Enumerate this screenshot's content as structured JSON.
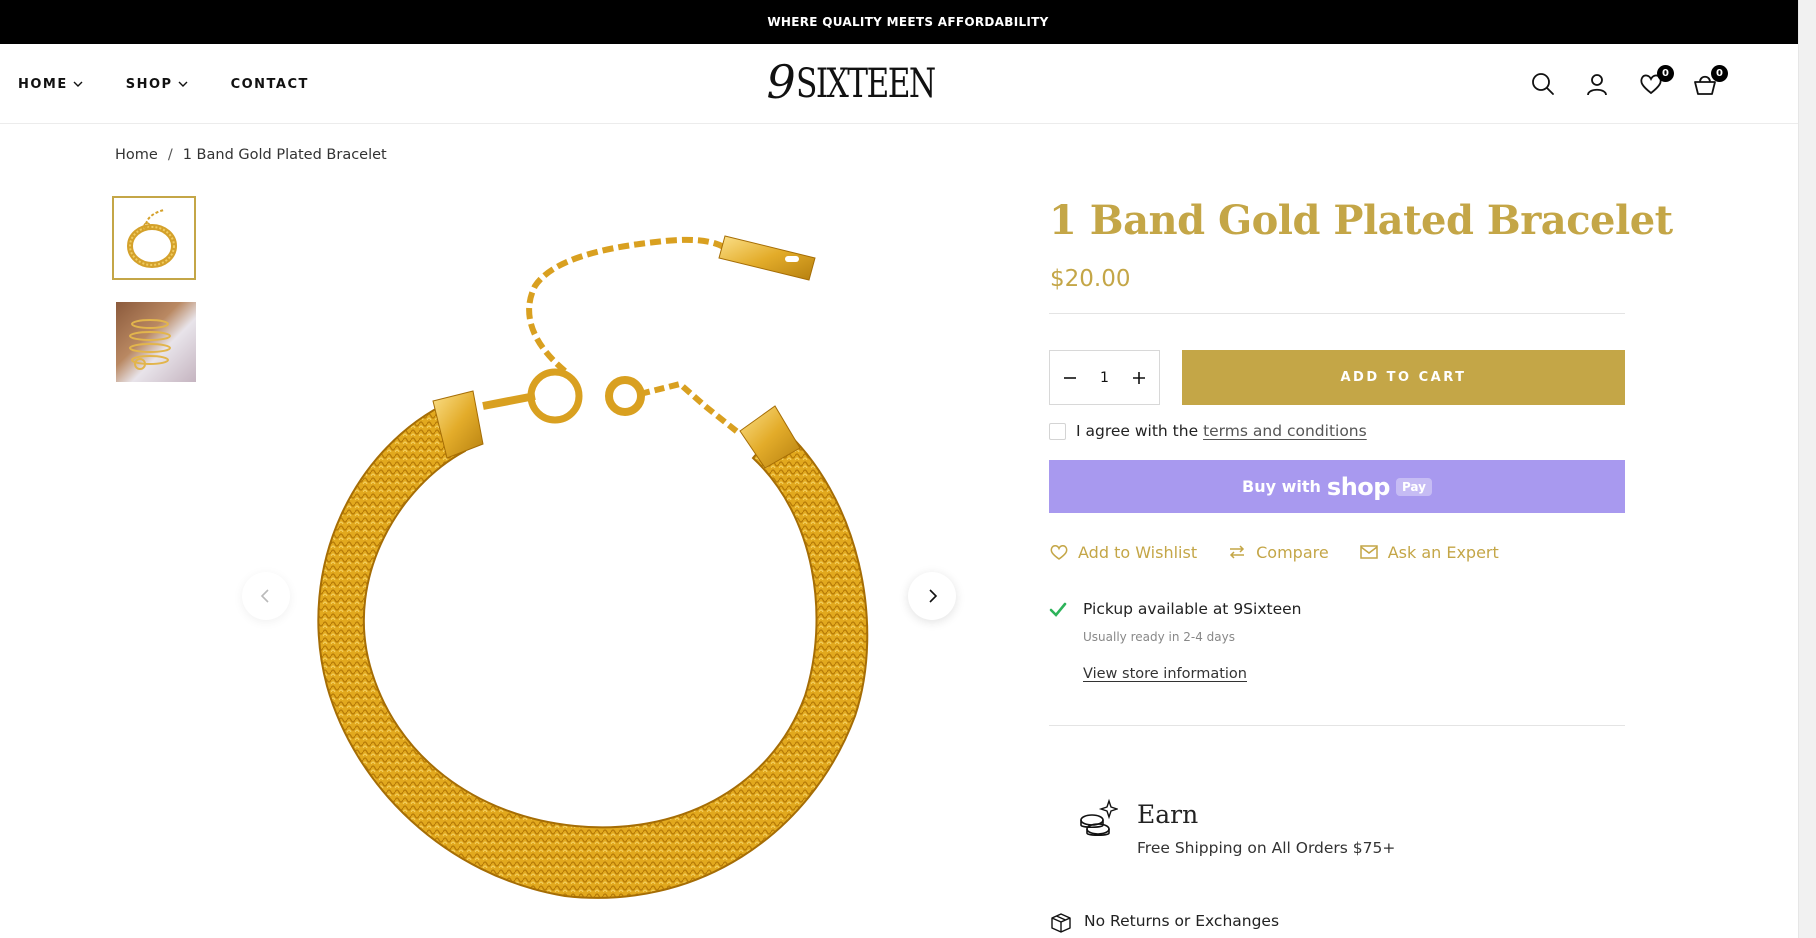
{
  "announcement": "WHERE QUALITY MEETS AFFORDABILITY",
  "nav": [
    {
      "label": "HOME",
      "dropdown": true
    },
    {
      "label": "SHOP",
      "dropdown": true
    },
    {
      "label": "CONTACT",
      "dropdown": false
    }
  ],
  "logo": {
    "nine": "9",
    "word": "SIXTEEN"
  },
  "header_icons": {
    "wishlist_count": "0",
    "cart_count": "0"
  },
  "breadcrumb": {
    "home": "Home",
    "separator": "/",
    "current": "1 Band Gold Plated Bracelet"
  },
  "product": {
    "title": "1 Band Gold Plated Bracelet",
    "price": "$20.00",
    "quantity": "1",
    "add_to_cart": "ADD TO CART",
    "agree_prefix": "I agree with the",
    "agree_link": "terms and conditions",
    "shop_pay": {
      "buy": "Buy with",
      "shop": "shop",
      "pay": "Pay"
    },
    "actions": {
      "wishlist": "Add to Wishlist",
      "compare": "Compare",
      "ask": "Ask an Expert"
    },
    "pickup": {
      "title": "Pickup available at 9Sixteen",
      "sub": "Usually ready in 2-4 days",
      "link": "View store information"
    },
    "earn": {
      "title": "Earn",
      "sub": "Free Shipping on All Orders $75+"
    },
    "returns": "No Returns or Exchanges"
  },
  "colors": {
    "accent": "#c4a647",
    "shop_pay": "#a899ef",
    "check": "#2db35a"
  }
}
